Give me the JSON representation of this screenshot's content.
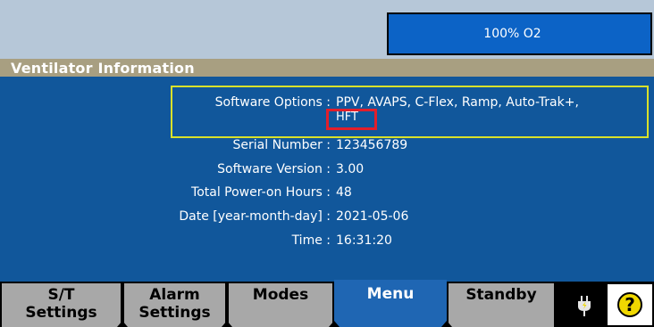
{
  "header": {
    "o2_label": "100% O2"
  },
  "section": {
    "title": "Ventilator Information"
  },
  "info": {
    "software_options_label": "Software Options :",
    "software_options_line1": "PPV, AVAPS, C-Flex, Ramp, Auto-Trak+,",
    "software_options_line2": "HFT",
    "serial_label": "Serial Number :",
    "serial_value": "123456789",
    "sw_version_label": "Software Version :",
    "sw_version_value": "3.00",
    "power_hours_label": "Total Power-on Hours :",
    "power_hours_value": "48",
    "date_label": "Date [year-month-day] :",
    "date_value": "2021-05-06",
    "time_label": "Time :",
    "time_value": "16:31:20"
  },
  "tabs": {
    "st_line1": "S/T",
    "st_line2": "Settings",
    "alarm_line1": "Alarm",
    "alarm_line2": "Settings",
    "modes": "Modes",
    "menu": "Menu",
    "standby": "Standby",
    "active": "Menu"
  },
  "help": {
    "glyph": "?"
  },
  "colors": {
    "background": "#11579b",
    "topbar": "#b6c7d8",
    "o2_button": "#0c63c6",
    "section_header": "#a89f81",
    "tab_inactive": "#a8a8a8",
    "tab_active": "#1f66b3",
    "highlight_yellow": "#d9e12a",
    "highlight_red": "#e21f2b",
    "help_yellow": "#f0d800"
  }
}
